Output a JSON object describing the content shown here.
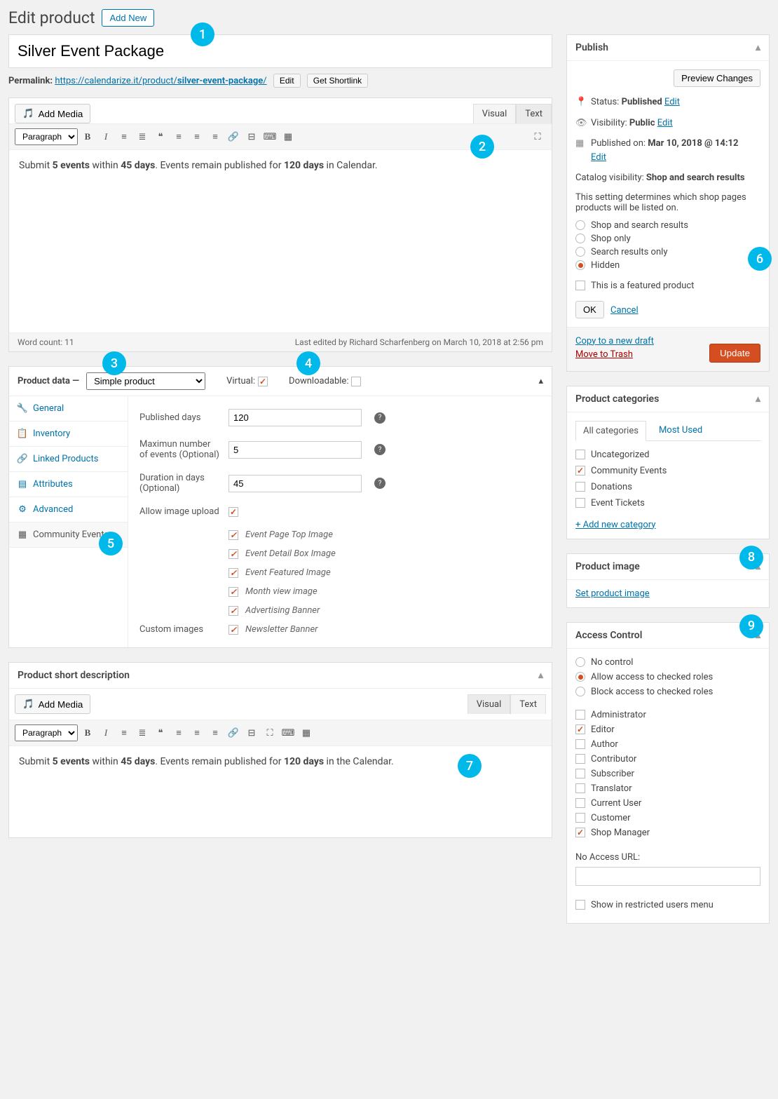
{
  "header": {
    "title": "Edit product",
    "add_new": "Add New"
  },
  "product_title": "Silver Event Package",
  "permalink": {
    "label": "Permalink:",
    "url": "https://calendarize.it/product/",
    "slug": "silver-event-package",
    "edit": "Edit",
    "shortlink": "Get Shortlink"
  },
  "editor": {
    "add_media": "Add Media",
    "tab_visual": "Visual",
    "tab_text": "Text",
    "format": "Paragraph",
    "content_pre": "Submit ",
    "content_b1": "5 events",
    "content_mid1": " within ",
    "content_b2": "45 days",
    "content_mid2": ". Events remain published for ",
    "content_b3": "120 days",
    "content_post": " in Calendar.",
    "word_count": "Word count: 11",
    "last_edited": "Last edited by Richard Scharfenberg on March 10, 2018 at 2:56 pm"
  },
  "product_data": {
    "title": "Product data",
    "type": "Simple product",
    "virtual_label": "Virtual:",
    "downloadable_label": "Downloadable:",
    "tabs": {
      "general": "General",
      "inventory": "Inventory",
      "linked": "Linked Products",
      "attributes": "Attributes",
      "advanced": "Advanced",
      "community": "Community Events"
    },
    "fields": {
      "published_days_label": "Published days",
      "published_days": "120",
      "max_events_label": "Maximun number of events (Optional)",
      "max_events": "5",
      "duration_label": "Duration in days (Optional)",
      "duration": "45",
      "allow_upload_label": "Allow image upload",
      "custom_images_label": "Custom images"
    },
    "image_options": {
      "top": "Event Page Top Image",
      "detail": "Event Detail Box Image",
      "featured": "Event Featured Image",
      "month": "Month view image",
      "ad": "Advertising Banner",
      "newsletter": "Newsletter Banner"
    }
  },
  "short_desc": {
    "title": "Product short description",
    "content_pre": "Submit ",
    "content_b1": "5 events",
    "content_mid1": " within ",
    "content_b2": "45 days",
    "content_mid2": ". Events remain published for ",
    "content_b3": "120 days",
    "content_post": " in the Calendar."
  },
  "publish": {
    "title": "Publish",
    "preview": "Preview Changes",
    "status_label": "Status:",
    "status": "Published",
    "visibility_label": "Visibility:",
    "visibility": "Public",
    "published_label": "Published on:",
    "published": "Mar 10, 2018 @ 14:12",
    "edit": "Edit",
    "catalog_label": "Catalog visibility:",
    "catalog": "Shop and search results",
    "catalog_desc": "This setting determines which shop pages products will be listed on.",
    "opts": {
      "shop_search": "Shop and search results",
      "shop_only": "Shop only",
      "search_only": "Search results only",
      "hidden": "Hidden"
    },
    "featured": "This is a featured product",
    "ok": "OK",
    "cancel": "Cancel",
    "copy": "Copy to a new draft",
    "trash": "Move to Trash",
    "update": "Update"
  },
  "categories": {
    "title": "Product categories",
    "tab_all": "All categories",
    "tab_most": "Most Used",
    "items": {
      "uncategorized": "Uncategorized",
      "community": "Community Events",
      "donations": "Donations",
      "tickets": "Event Tickets"
    },
    "add_new": "+ Add new category"
  },
  "product_image": {
    "title": "Product image",
    "link": "Set product image"
  },
  "access": {
    "title": "Access Control",
    "opts": {
      "none": "No control",
      "allow": "Allow access to checked roles",
      "block": "Block access to checked roles"
    },
    "roles": {
      "admin": "Administrator",
      "editor": "Editor",
      "author": "Author",
      "contributor": "Contributor",
      "subscriber": "Subscriber",
      "translator": "Translator",
      "current": "Current User",
      "customer": "Customer",
      "shopmgr": "Shop Manager"
    },
    "url_label": "No Access URL:",
    "show_restricted": "Show in restricted users menu"
  }
}
